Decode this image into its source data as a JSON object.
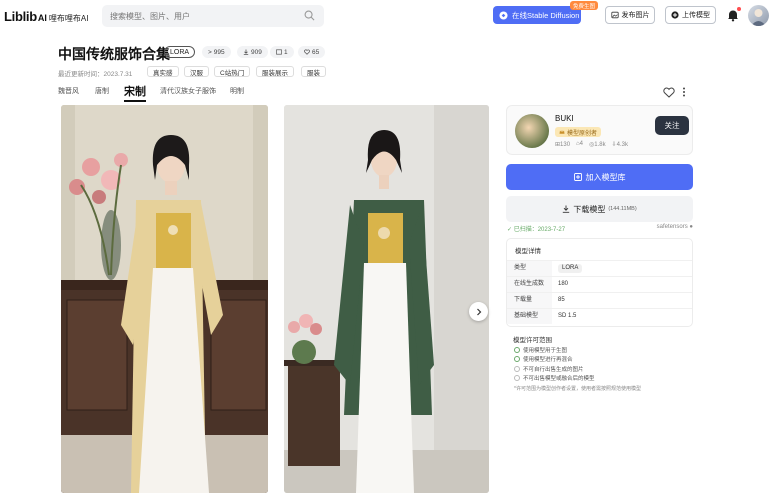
{
  "header": {
    "logo_main": "Liblib",
    "logo_ai": "AI",
    "logo_cn": "哩布哩布AI",
    "search_placeholder": "搜索模型、图片、用户",
    "sd_button": "在线Stable Diffusion",
    "sd_badge": "免费生图",
    "publish_button": "发布图片",
    "upload_button": "上传模型"
  },
  "model": {
    "title": "中国传统服饰合集",
    "type_tag": "LORA",
    "stats": [
      {
        "icon": "run-icon",
        "value": "995"
      },
      {
        "icon": "download-icon",
        "value": "909"
      },
      {
        "icon": "image-icon",
        "value": "1"
      },
      {
        "icon": "heart-icon",
        "value": "65"
      }
    ],
    "updated": "最近更新时间：2023.7.31",
    "tags": [
      "真实感",
      "汉服",
      "C站热门",
      "服装展示",
      "服装"
    ],
    "tabs": [
      "魏晋风",
      "唐制",
      "宋制",
      "清代汉族女子服饰",
      "明制"
    ],
    "active_tab": 2
  },
  "author": {
    "name": "BUKI",
    "badge": "模型原创者",
    "stats": [
      "130",
      "4",
      "1.8k",
      "4.3k"
    ],
    "follow_label": "关注"
  },
  "actions": {
    "add_to_library": "加入模型库",
    "download": "下载模型",
    "download_size": "(144.11MB)",
    "scan_label": "已扫描：2023-7-27",
    "scan_right": "safetensors"
  },
  "details": {
    "title": "模型详情",
    "rows": [
      {
        "key": "类型",
        "value": "LORA"
      },
      {
        "key": "在线生成数",
        "value": "180"
      },
      {
        "key": "下载量",
        "value": "85"
      },
      {
        "key": "基础模型",
        "value": "SD 1.5"
      }
    ]
  },
  "license": {
    "title": "模型许可范围",
    "items": [
      {
        "text": "使用模型用于生图",
        "allowed": true
      },
      {
        "text": "使用模型进行再混合",
        "allowed": true
      },
      {
        "text": "不可自行出售生成的图片",
        "allowed": false
      },
      {
        "text": "不可出售模型或融合后的模型",
        "allowed": false
      }
    ],
    "note": "*许可范围为模型创作者设置，使用者需按照规范使用模型"
  },
  "colors": {
    "primary": "#4f6df5",
    "badge_orange": "#ff8a3d",
    "follow_dark": "#2b3340"
  }
}
